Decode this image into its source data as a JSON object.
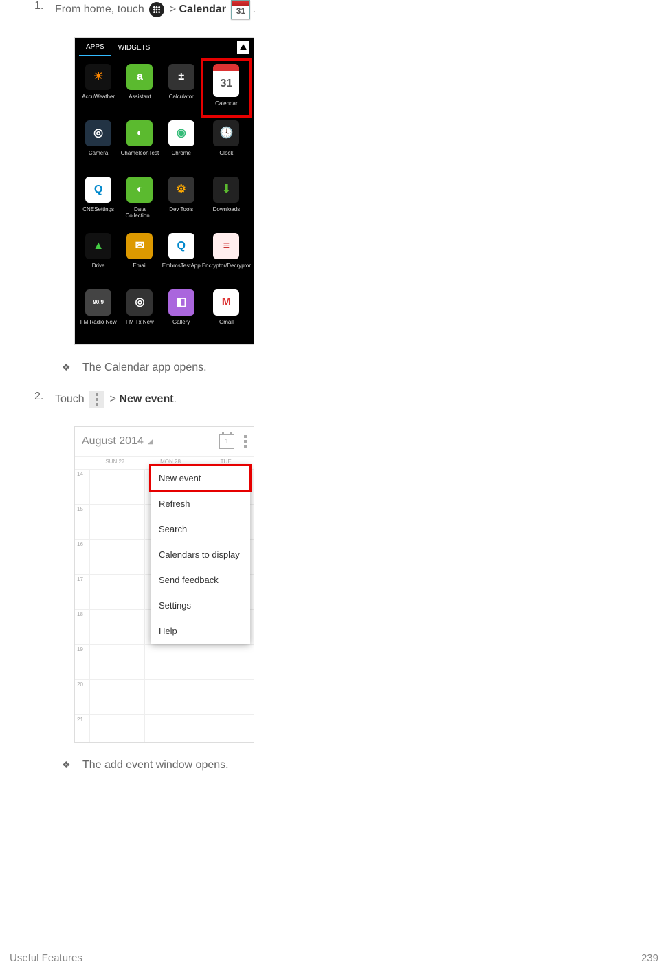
{
  "step1": {
    "number": "1.",
    "pre": "From home, touch",
    "sep": ">",
    "bold": "Calendar",
    "period": ".",
    "cal_icon_text": "31",
    "result_bullet": "❖",
    "result": "The Calendar app opens."
  },
  "step2": {
    "number": "2.",
    "pre": "Touch",
    "sep": ">",
    "bold": "New event",
    "period": ".",
    "result_bullet": "❖",
    "result": "The add event window opens."
  },
  "drawer": {
    "tab_apps": "APPS",
    "tab_widgets": "WIDGETS",
    "apps": [
      {
        "name": "AccuWeather",
        "bg": "#111",
        "inner": "☀",
        "innerColor": "#f80"
      },
      {
        "name": "Assistant",
        "bg": "#5bba2f",
        "inner": "a"
      },
      {
        "name": "Calculator",
        "bg": "#333",
        "inner": "±"
      },
      {
        "name": "Calendar",
        "bg": "#fff",
        "inner": "31",
        "innerColor": "#555",
        "highlight": true,
        "calendar": true
      },
      {
        "name": "Camera",
        "bg": "#234",
        "inner": "◎"
      },
      {
        "name": "ChameleonTest",
        "bg": "#5bba2f",
        "inner": "◐"
      },
      {
        "name": "Chrome",
        "bg": "#fff",
        "inner": "◉",
        "innerColor": "#3b7"
      },
      {
        "name": "Clock",
        "bg": "#222",
        "inner": "🕓"
      },
      {
        "name": "CNESettings",
        "bg": "#fff",
        "inner": "Q",
        "innerColor": "#08c"
      },
      {
        "name": "Data Collection...",
        "bg": "#5bba2f",
        "inner": "◐"
      },
      {
        "name": "Dev Tools",
        "bg": "#333",
        "inner": "⚙",
        "innerColor": "#fa0"
      },
      {
        "name": "Downloads",
        "bg": "#222",
        "inner": "⬇",
        "innerColor": "#5bba2f"
      },
      {
        "name": "Drive",
        "bg": "#111",
        "inner": "▲",
        "innerColor": "#4c4"
      },
      {
        "name": "Email",
        "bg": "#d90",
        "inner": "✉"
      },
      {
        "name": "EmbmsTestApp",
        "bg": "#fff",
        "inner": "Q",
        "innerColor": "#08c"
      },
      {
        "name": "Encryptor/Decryptor",
        "bg": "#fee",
        "inner": "≡",
        "innerColor": "#c33"
      },
      {
        "name": "FM Radio New",
        "bg": "#444",
        "inner": "90.9",
        "innerColor": "#fff",
        "fs": "8px"
      },
      {
        "name": "FM Tx New",
        "bg": "#333",
        "inner": "◎"
      },
      {
        "name": "Gallery",
        "bg": "#a6d",
        "inner": "◧"
      },
      {
        "name": "Gmail",
        "bg": "#fff",
        "inner": "M",
        "innerColor": "#d33"
      }
    ]
  },
  "calshot": {
    "title": "August 2014",
    "today_num": "1",
    "days": [
      "SUN 27",
      "MON 28",
      "TUE"
    ],
    "hours": [
      "14",
      "15",
      "16",
      "17",
      "18",
      "19",
      "20",
      "21"
    ],
    "menu": [
      {
        "label": "New event",
        "highlight": true
      },
      {
        "label": "Refresh"
      },
      {
        "label": "Search"
      },
      {
        "label": "Calendars to display"
      },
      {
        "label": "Send feedback"
      },
      {
        "label": "Settings"
      },
      {
        "label": "Help"
      }
    ]
  },
  "footer": {
    "section": "Useful Features",
    "page": "239"
  }
}
